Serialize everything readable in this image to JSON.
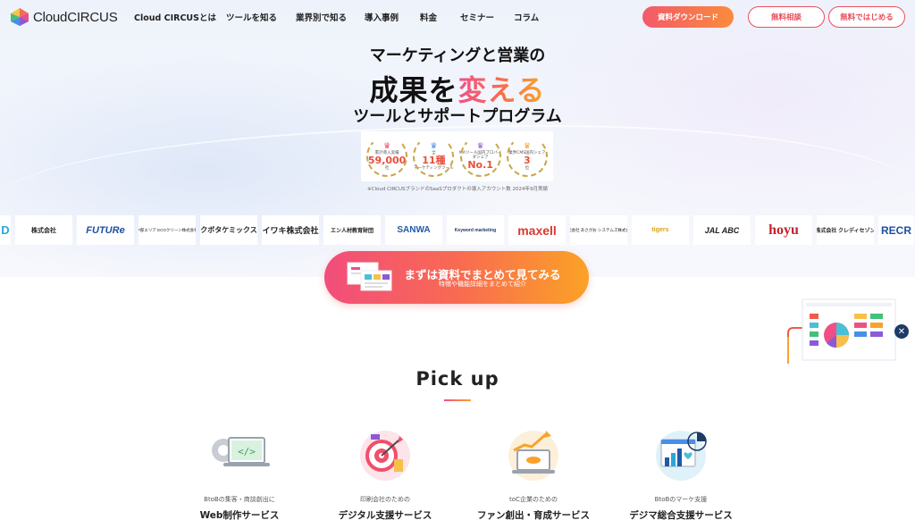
{
  "header": {
    "logo": "CloudCIRCUS",
    "nav": [
      "Cloud CIRCUSとは",
      "ツールを知る",
      "業界別で知る",
      "導入事例",
      "料金",
      "セミナー",
      "コラム"
    ],
    "btn_download": "資料ダウンロード",
    "btn_consult": "無料相談",
    "btn_free": "無料ではじめる"
  },
  "hero": {
    "line1": "マーケティングと営業の",
    "line2_a": "成果を",
    "line2_b": "変える",
    "line3": "ツールとサポートプログラム"
  },
  "awards": [
    {
      "label": "累計導入実績",
      "value": "59,000",
      "unit": "社"
    },
    {
      "label": "全",
      "value": "11種",
      "unit": "マーケティングツール"
    },
    {
      "label": "MAツール国内ブロバイダシェア",
      "value": "No.1",
      "unit": ""
    },
    {
      "label": "業界CMS国内シェア",
      "value": "3",
      "unit": "位"
    }
  ],
  "award_note": "※Cloud CIRCUSブランドのSaaSプロダクトの導入アカウント数 2024年9月実績",
  "clients": [
    "D",
    "株式会社",
    "FUTURe",
    "中部エリア ECOクリーン株式会社",
    "クボタケミックス",
    "イワキ株式会社",
    "エン人材教育財団",
    "SANWA",
    "Keyword marketing",
    "maxell",
    "株式会社 あさがお システムズ株式会社",
    "tigers",
    "JAL ABC",
    "hoyu",
    "株式会社 クレディセゾン",
    "RECR"
  ],
  "cta": {
    "main": "まずは資料でまとめて見てみる",
    "sub": "特徴や機能詳細をまとめて紹介"
  },
  "pickup": {
    "title": "Pick up",
    "cards": [
      {
        "sub": "BtoBの集客・商談創出に",
        "title": "Web制作サービス",
        "icon": "web-code-icon"
      },
      {
        "sub": "印刷会社のための",
        "title": "デジタル支援サービス",
        "icon": "target-icon"
      },
      {
        "sub": "toC企業のための",
        "title": "ファン創出・育成サービス",
        "icon": "growth-laptop-icon"
      },
      {
        "sub": "BtoBのマーケ支援",
        "title": "デジマ総合支援サービス",
        "icon": "analytics-heart-icon"
      }
    ]
  },
  "colors": {
    "accent_pink": "#f04f86",
    "accent_orange": "#fba22b",
    "button_red": "#e84f5e"
  }
}
